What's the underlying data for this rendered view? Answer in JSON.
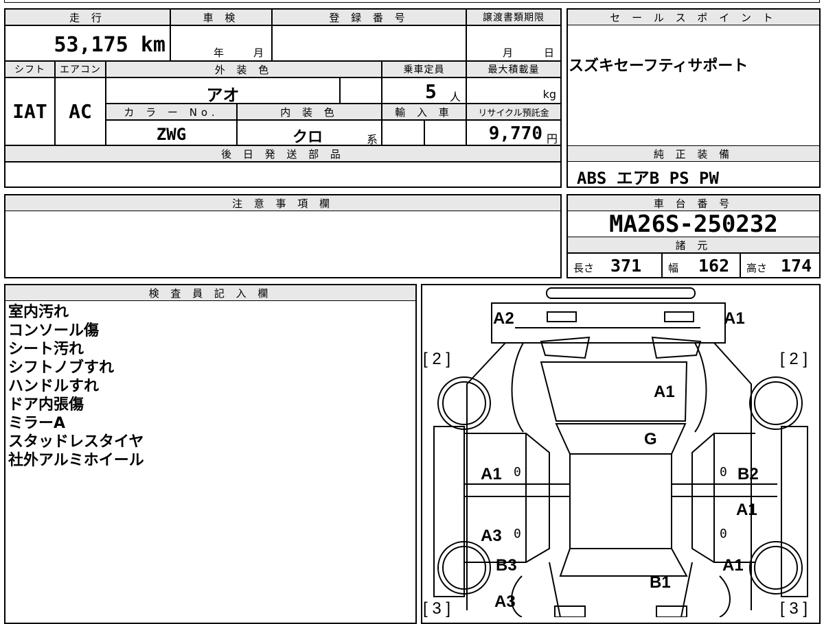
{
  "vehicle": {
    "mileage_header": "走 行",
    "mileage_value": "53,175 km",
    "shaken_header": "車 検",
    "shaken_year": "年",
    "shaken_month": "月",
    "reg_header": "登 録 番 号",
    "transfer_header": "譲渡書類期限",
    "transfer_month": "月",
    "transfer_day": "日",
    "shift_header": "シフト",
    "ac_header": "エアコン",
    "color_header": "外 装 色",
    "seating_header": "乗車定員",
    "maxload_header": "最大積載量",
    "shift_value": "IAT",
    "ac_value": "AC",
    "exterior_color": "アオ",
    "seating_value": "5",
    "seating_unit": "人",
    "maxload_unit": "kg",
    "colorno_header": "カ ラ ー No.",
    "interior_header": "内 装 色",
    "import_header": "輸 入 車",
    "recycle_header": "リサイクル預託金",
    "color_no": "ZWG",
    "interior_color": "クロ",
    "interior_suffix": "系",
    "recycle_value": "9,770",
    "recycle_unit": "円",
    "later_parts_header": "後 日 発 送 部 品"
  },
  "sales": {
    "header": "セ ー ル ス ポ イ ン ト",
    "text": "スズキセーフティサポート",
    "equip_header": "純 正 装 備",
    "equip_text": "ABS エアB PS PW"
  },
  "notes": {
    "header": "注 意 事 項 欄"
  },
  "chassis": {
    "header": "車 台 番 号",
    "value": "MA26S-250232",
    "spec_header": "諸 元",
    "length_label": "長さ",
    "length_value": "371",
    "width_label": "幅",
    "width_value": "162",
    "height_label": "高さ",
    "height_value": "174"
  },
  "inspector": {
    "header": "検 査 員 記 入 欄",
    "lines": [
      "室内汚れ",
      "コンソール傷",
      "シート汚れ",
      "シフトノブすれ",
      "ハンドルすれ",
      "ドア内張傷",
      "ミラーA",
      "スタッドレスタイヤ",
      "社外アルミホイール"
    ]
  },
  "diagram": {
    "labels": {
      "front_left": "A2",
      "front_right": "A1",
      "hood": "A1",
      "windshield": "G",
      "left_front_door": "A1",
      "left_rear_door": "A3",
      "right_front_door": "B2",
      "right_rear_door": "A1",
      "left_rear_fender": "B3",
      "left_rear_bottom": "A3",
      "rear": "B1",
      "right_rear_fender": "A1",
      "left_tire_top": "[ 2 ]",
      "right_tire_top": "[ 2 ]",
      "left_tire_bottom": "[ 3 ]",
      "right_tire_bottom": "[ 3 ]",
      "zero": "0"
    }
  }
}
